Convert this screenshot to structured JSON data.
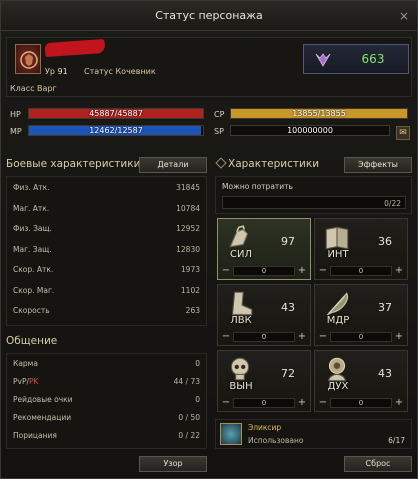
{
  "window": {
    "title": "Статус персонажа",
    "close": "×"
  },
  "character": {
    "level_label": "Ур",
    "level": "91",
    "status_label": "Статус",
    "status": "Кочевник",
    "class_label": "Класс",
    "class": "Варг",
    "power": "663"
  },
  "bars": {
    "hp": {
      "label": "HP",
      "text": "45887/45887",
      "fill": 1.0,
      "color": "#b0221f"
    },
    "mp": {
      "label": "MP",
      "text": "12462/12587",
      "fill": 0.99,
      "color": "#1e54b8"
    },
    "cp": {
      "label": "CP",
      "text": "13855/13855",
      "fill": 1.0,
      "color": "#c9962a"
    },
    "sp": {
      "label": "SP",
      "text": "100000000",
      "fill": 0.0,
      "color": "#555"
    }
  },
  "combat": {
    "title": "Боевые характеристики",
    "details_button": "Детали",
    "rows": [
      {
        "k": "Физ. Атк.",
        "v": "31845"
      },
      {
        "k": "Маг. Атк.",
        "v": "10784"
      },
      {
        "k": "Физ. Защ.",
        "v": "12952"
      },
      {
        "k": "Маг. Защ.",
        "v": "12830"
      },
      {
        "k": "Скор. Атк.",
        "v": "1973"
      },
      {
        "k": "Скор. Маг.",
        "v": "1102"
      },
      {
        "k": "Скорость",
        "v": "263"
      }
    ]
  },
  "social": {
    "title": "Общение",
    "rows": [
      {
        "k": "Карма",
        "v": "0"
      },
      {
        "k_pvp": "PvP",
        "k_sep": "/",
        "k_pk": "PK",
        "v": "44 / 73"
      },
      {
        "k": "Рейдовые очки",
        "v": "0"
      },
      {
        "k": "Рекомендации",
        "v": "0 / 50"
      },
      {
        "k": "Порицания",
        "v": "0 / 22"
      }
    ],
    "view_button": "Узор"
  },
  "stats": {
    "title": "Характеристики",
    "effects_button": "Эффекты",
    "free_label": "Можно потратить",
    "free_count": "0/22",
    "items": [
      {
        "abbr": "СИЛ",
        "value": "97",
        "alloc": "0",
        "icon": "fist-icon"
      },
      {
        "abbr": "ИНТ",
        "value": "36",
        "alloc": "0",
        "icon": "book-icon"
      },
      {
        "abbr": "ЛВК",
        "value": "43",
        "alloc": "0",
        "icon": "boot-icon"
      },
      {
        "abbr": "МДР",
        "value": "37",
        "alloc": "0",
        "icon": "feather-icon"
      },
      {
        "abbr": "ВЫН",
        "value": "72",
        "alloc": "0",
        "icon": "skull-icon"
      },
      {
        "abbr": "ДУХ",
        "value": "43",
        "alloc": "0",
        "icon": "spirit-icon"
      }
    ],
    "minus": "−",
    "plus": "+",
    "elixir_name": "Эликсир",
    "elixir_used_label": "Использовано",
    "elixir_count": "6/17",
    "reset_button": "Сброс"
  }
}
